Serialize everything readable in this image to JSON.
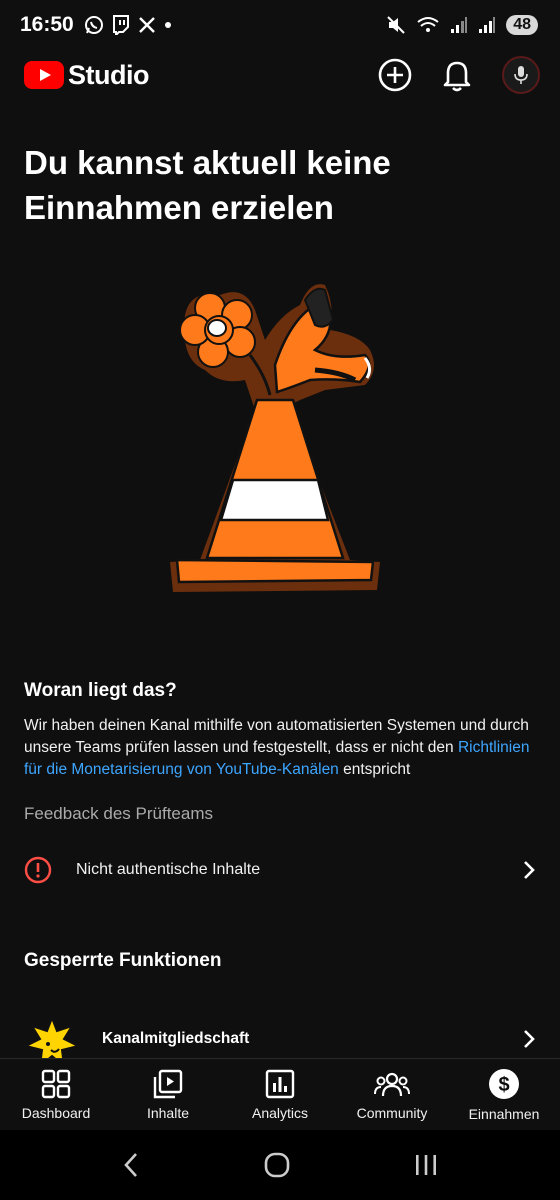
{
  "status_bar": {
    "time": "16:50",
    "battery": "48",
    "left_icons": [
      "whatsapp-icon",
      "twitch-icon",
      "x-icon",
      "dot-icon"
    ],
    "right_icons": [
      "mute-icon",
      "wifi-icon",
      "signal-icon",
      "signal-icon"
    ]
  },
  "app_bar": {
    "logo_text": "Studio",
    "brand_color": "#ff0000",
    "actions": [
      "create-icon",
      "bell-icon",
      "avatar"
    ]
  },
  "headline": "Du kannst aktuell keine Einnahmen erzielen",
  "reason_section": {
    "title": "Woran liegt das?",
    "text_before": "Wir haben deinen Kanal mithilfe von automatisierten Systemen und durch unsere Teams prüfen lassen und festgestellt, dass er nicht den ",
    "link_text": "Richtlinien für die Monetarisierung von YouTube-Kanälen",
    "text_after": " entspricht",
    "link_color": "#3ea6ff"
  },
  "feedback": {
    "label": "Feedback des Prüfteams",
    "item": "Nicht authentische Inhalte",
    "alert_color": "#ff4e45"
  },
  "locked_features": {
    "title": "Gesperrte Funktionen",
    "item": "Kanalmitgliedschaft"
  },
  "bottom_nav": {
    "items": [
      {
        "label": "Dashboard",
        "icon": "dashboard-icon"
      },
      {
        "label": "Inhalte",
        "icon": "content-icon"
      },
      {
        "label": "Analytics",
        "icon": "analytics-icon"
      },
      {
        "label": "Community",
        "icon": "community-icon"
      },
      {
        "label": "Einnahmen",
        "icon": "earn-icon",
        "selected": true
      }
    ]
  }
}
